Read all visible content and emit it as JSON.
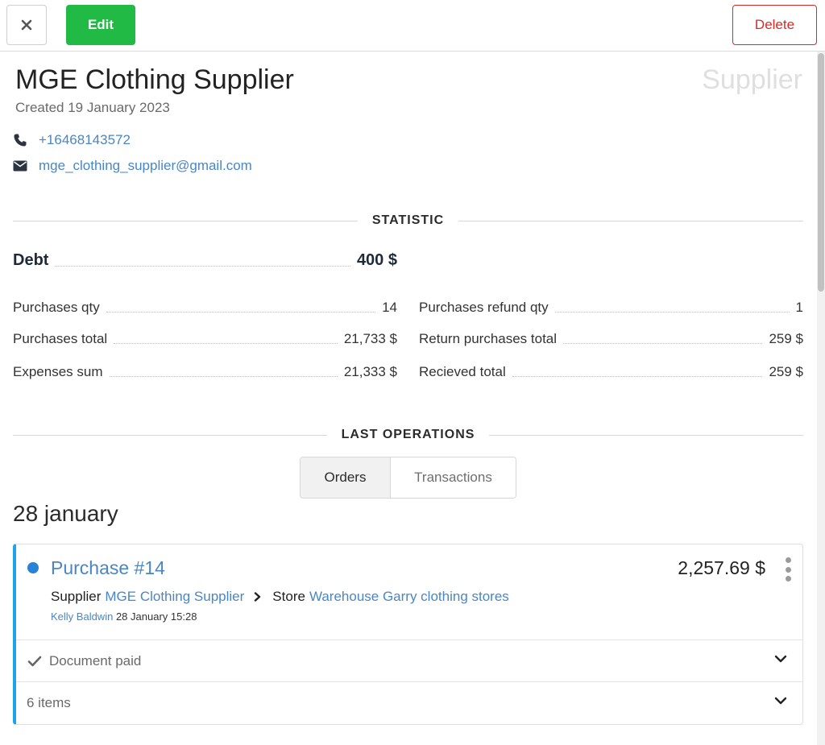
{
  "toolbar": {
    "close_icon": "close-x-icon",
    "edit_label": "Edit",
    "delete_label": "Delete"
  },
  "header": {
    "title": "MGE Clothing Supplier",
    "role": "Supplier",
    "created": "Created 19 January 2023"
  },
  "contacts": {
    "phone": "+16468143572",
    "email": "mge_clothing_supplier@gmail.com"
  },
  "statistic": {
    "title": "STATISTIC",
    "debt": {
      "label": "Debt",
      "value": "400 $"
    },
    "left": [
      {
        "label": "Purchases qty",
        "value": "14"
      },
      {
        "label": "Purchases total",
        "value": "21,733 $"
      },
      {
        "label": "Expenses sum",
        "value": "21,333 $"
      }
    ],
    "right": [
      {
        "label": "Purchases refund qty",
        "value": "1"
      },
      {
        "label": "Return purchases total",
        "value": "259 $"
      },
      {
        "label": "Recieved total",
        "value": "259 $"
      }
    ]
  },
  "operations": {
    "title": "LAST OPERATIONS",
    "tabs": [
      {
        "label": "Orders",
        "active": true
      },
      {
        "label": "Transactions",
        "active": false
      }
    ],
    "date_group": "28 january",
    "card": {
      "name": "Purchase #14",
      "amount": "2,257.69 $",
      "supplier_label": "Supplier",
      "supplier_name": "MGE Clothing Supplier",
      "store_label": "Store",
      "store_name": "Warehouse Garry clothing stores",
      "user": "Kelly Baldwin",
      "datetime": "28 January 15:28",
      "status": "Document paid",
      "items": "6 items",
      "accent_color": "#1fa3e8",
      "status_dot_color": "#2a82d6"
    }
  },
  "colors": {
    "edit": "#21ba45",
    "delete": "#db2828",
    "link": "#4a86c5"
  }
}
